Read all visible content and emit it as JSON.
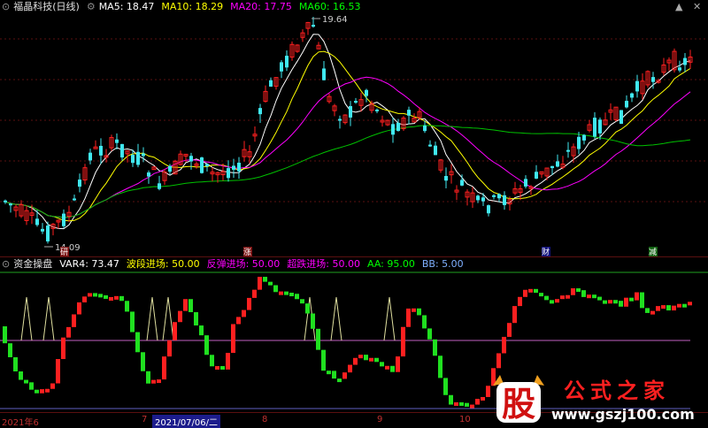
{
  "main": {
    "title": "福晶科技(日线)",
    "ma": [
      {
        "label": "MA5: 18.47",
        "color": "#ffffff"
      },
      {
        "label": "MA10: 18.29",
        "color": "#ffff00"
      },
      {
        "label": "MA20: 17.75",
        "color": "#ff00ff"
      },
      {
        "label": "MA60: 16.53",
        "color": "#00ff00"
      }
    ],
    "high_label": "19.64",
    "low_label": "14.09",
    "event_markers": [
      "研",
      "涨",
      "财",
      "减"
    ]
  },
  "indicator": {
    "title": "资金操盘",
    "fields": [
      {
        "label": "VAR4: 73.47",
        "color": "#ffffff"
      },
      {
        "label": "波段进场: 50.00",
        "color": "#ffff00"
      },
      {
        "label": "反弹进场: 50.00",
        "color": "#ff00ff"
      },
      {
        "label": "超跌进场: 50.00",
        "color": "#ff00ff"
      },
      {
        "label": "AA: 95.00",
        "color": "#00ff00"
      },
      {
        "label": "BB: 5.00",
        "color": "#7fb0ff"
      }
    ]
  },
  "axis": {
    "labels": [
      "2021年6",
      "7",
      "2021/07/06/二",
      "8",
      "9",
      "10"
    ]
  },
  "window_controls": {
    "up": "▲",
    "close": "✕"
  },
  "watermark": {
    "char": "股",
    "name": "公式之家",
    "url": "www.gszj100.com"
  },
  "colors": {
    "up": "#ff2020",
    "down": "#40e8f0",
    "ind_up": "#ff2020",
    "ind_down": "#20e020"
  },
  "chart_data": {
    "type": "candlestick",
    "price_high": 19.64,
    "price_low": 14.09,
    "ma": {
      "MA5": 18.47,
      "MA10": 18.29,
      "MA20": 17.75,
      "MA60": 16.53
    },
    "indicator": {
      "VAR4": 73.47,
      "波段进场": 50.0,
      "反弹进场": 50.0,
      "超跌进场": 50.0,
      "AA": 95.0,
      "BB": 5.0
    }
  }
}
